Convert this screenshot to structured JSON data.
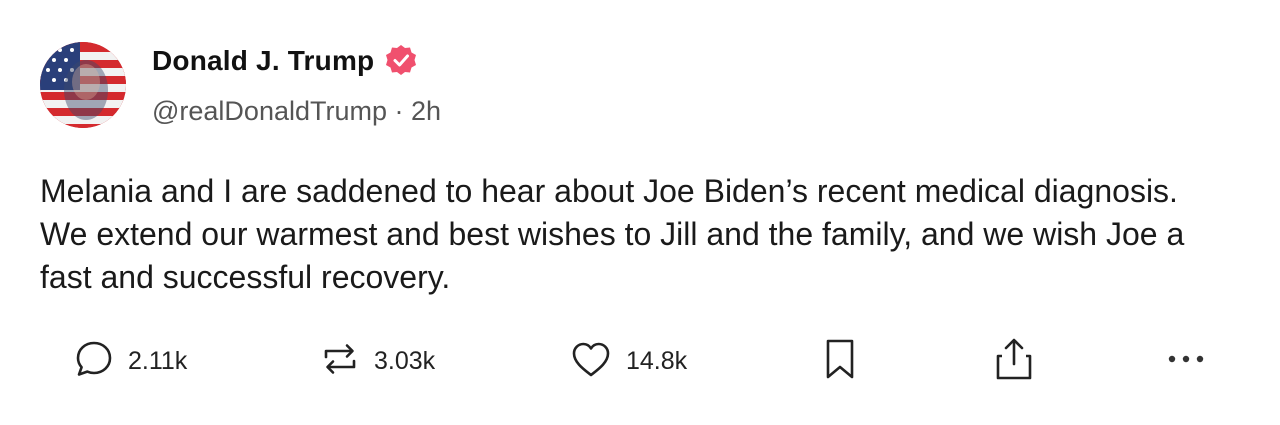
{
  "post": {
    "author": {
      "display_name": "Donald J. Trump",
      "handle": "@realDonaldTrump",
      "separator": "·",
      "time_ago": "2h",
      "verified": true,
      "verified_color": "#f0506e"
    },
    "text": "Melania and I are saddened to hear about Joe Biden’s recent medical diagnosis. We extend our warmest and best wishes to Jill and the family, and we wish Joe a fast and successful recovery.",
    "actions": {
      "replies": "2.11k",
      "reposts": "3.03k",
      "likes": "14.8k"
    },
    "icons": {
      "reply": "speech-bubble-icon",
      "repost": "repost-arrows-icon",
      "like": "heart-icon",
      "bookmark": "bookmark-icon",
      "share": "share-icon",
      "more": "more-dots-icon"
    }
  }
}
